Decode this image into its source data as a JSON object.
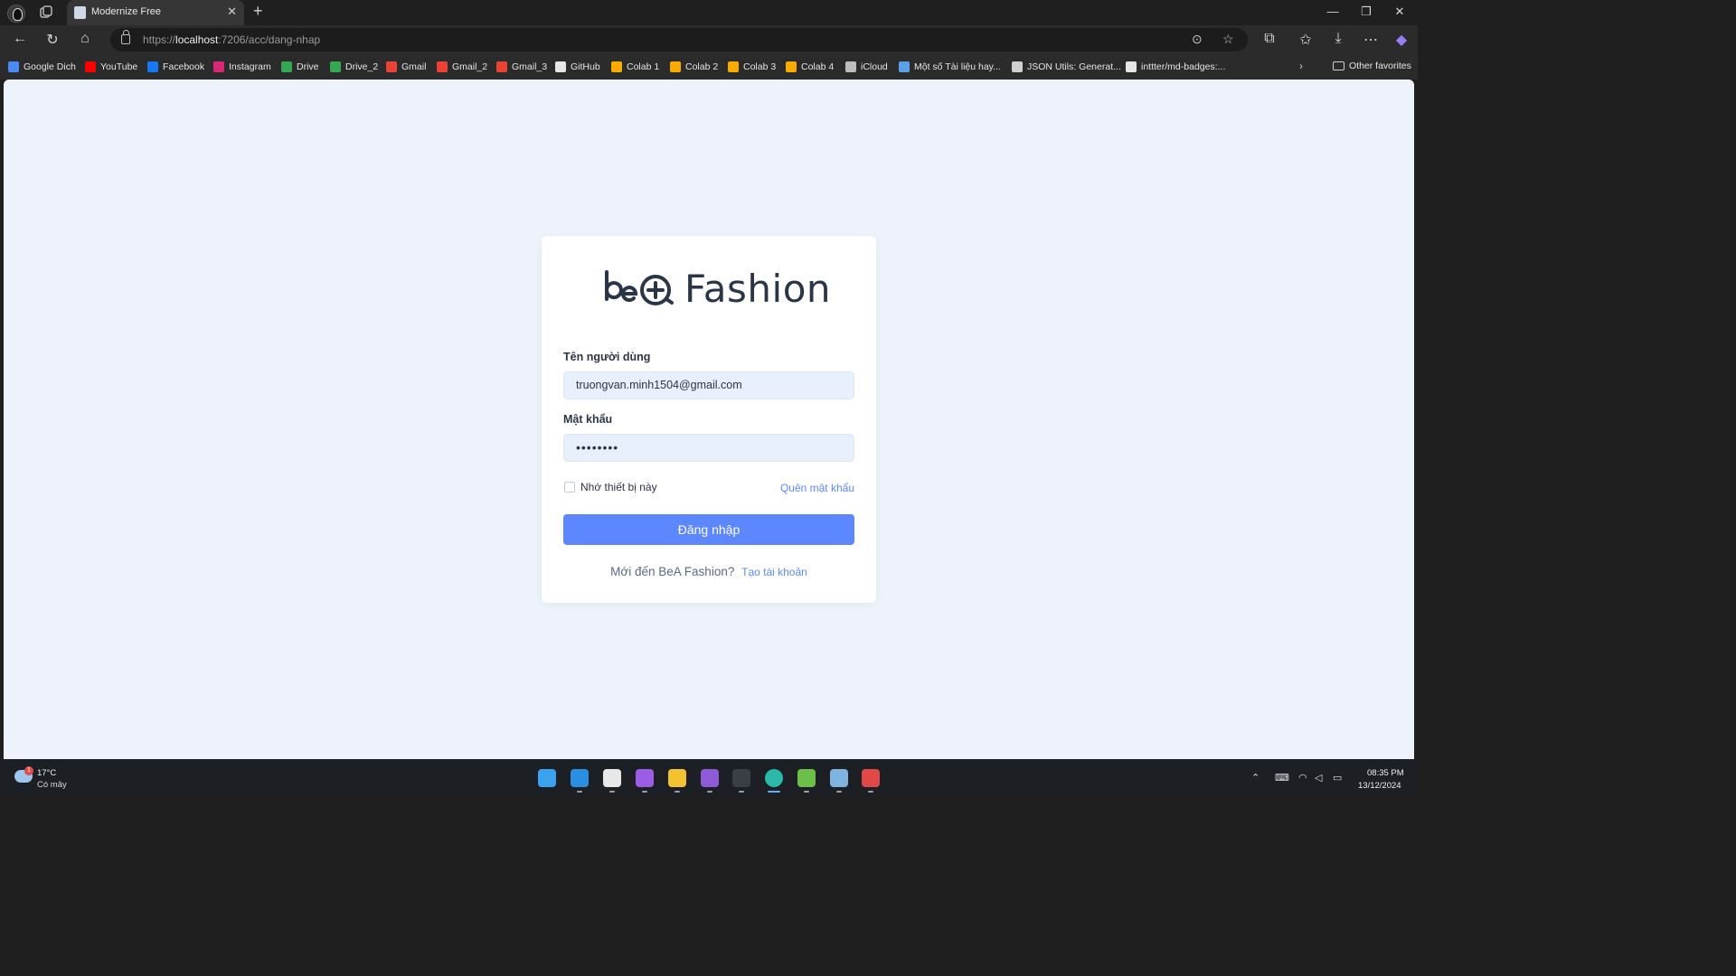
{
  "browser": {
    "tab_title": "Modernize Free",
    "url_scheme": "https://",
    "url_host": "localhost",
    "url_path": ":7206/acc/dang-nhap",
    "bookmarks": [
      {
        "label": "Google Dich",
        "icon": "google-translate-icon",
        "color": "#4a8af4"
      },
      {
        "label": "YouTube",
        "icon": "youtube-icon",
        "color": "#ff0000"
      },
      {
        "label": "Facebook",
        "icon": "facebook-icon",
        "color": "#1877f2"
      },
      {
        "label": "Instagram",
        "icon": "instagram-icon",
        "color": "#d62976"
      },
      {
        "label": "Drive",
        "icon": "drive-icon",
        "color": "#34a853"
      },
      {
        "label": "Drive_2",
        "icon": "drive-icon",
        "color": "#34a853"
      },
      {
        "label": "Gmail",
        "icon": "gmail-icon",
        "color": "#ea4335"
      },
      {
        "label": "Gmail_2",
        "icon": "gmail-icon",
        "color": "#ea4335"
      },
      {
        "label": "Gmail_3",
        "icon": "gmail-icon",
        "color": "#ea4335"
      },
      {
        "label": "GitHub",
        "icon": "github-icon",
        "color": "#e6e6e6"
      },
      {
        "label": "Colab 1",
        "icon": "colab-icon",
        "color": "#f9ab00"
      },
      {
        "label": "Colab 2",
        "icon": "colab-icon",
        "color": "#f9ab00"
      },
      {
        "label": "Colab 3",
        "icon": "colab-icon",
        "color": "#f9ab00"
      },
      {
        "label": "Colab 4",
        "icon": "colab-icon",
        "color": "#f9ab00"
      },
      {
        "label": "iCloud",
        "icon": "apple-icon",
        "color": "#bdbdbd"
      },
      {
        "label": "Một số Tài liệu hay...",
        "icon": "bookmark-m-icon",
        "color": "#5aa0e6"
      },
      {
        "label": "JSON Utils: Generat...",
        "icon": "globe-icon",
        "color": "#d0d0d0"
      },
      {
        "label": "inttter/md-badges:...",
        "icon": "github-icon",
        "color": "#e6e6e6"
      }
    ],
    "other_favorites": "Other favorites"
  },
  "login": {
    "brand": "Fashion",
    "username_label": "Tên người dùng",
    "username_value": "truongvan.minh1504@gmail.com",
    "password_label": "Mật khẩu",
    "password_masked": "••••••••",
    "remember_label": "Nhớ thiết bị này",
    "forgot_label": "Quên mật khẩu",
    "submit_label": "Đăng nhập",
    "signup_prompt": "Mới đến BeA Fashion?",
    "signup_link": "Tạo tài khoản",
    "accent_color": "#5d87ff"
  },
  "taskbar": {
    "weather_badge": "1",
    "weather_temp": "17°C",
    "weather_desc": "Có mây",
    "apps": [
      {
        "name": "windows-start-icon",
        "color": "#3ba2f0"
      },
      {
        "name": "vscode-icon",
        "color": "#2a8fe0"
      },
      {
        "name": "chatgpt-icon",
        "color": "#e8e8e8"
      },
      {
        "name": "github-desktop-icon",
        "color": "#9b5de5"
      },
      {
        "name": "file-explorer-icon",
        "color": "#f2c230"
      },
      {
        "name": "visual-studio-icon",
        "color": "#8e5bd6"
      },
      {
        "name": "terminal-icon",
        "color": "#3a3f46"
      },
      {
        "name": "edge-icon",
        "color": "#2ab8a8"
      },
      {
        "name": "snipping-tool-icon",
        "color": "#6cc04a"
      },
      {
        "name": "task-manager-icon",
        "color": "#7fb3e0"
      },
      {
        "name": "mail-app-icon",
        "color": "#e04848"
      }
    ],
    "time": "08:35 PM",
    "date": "13/12/2024"
  }
}
